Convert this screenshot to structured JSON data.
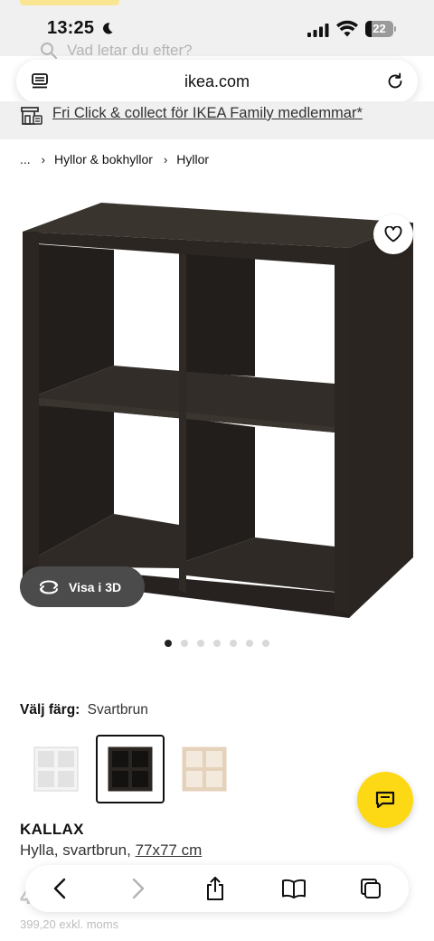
{
  "status_bar": {
    "time": "13:25",
    "battery": "22"
  },
  "site_search": {
    "placeholder": "Vad letar du efter?"
  },
  "address_bar": {
    "url": "ikea.com"
  },
  "promo": {
    "text": "Fri Click & collect för IKEA Family medlemmar*"
  },
  "breadcrumb": {
    "ellipsis": "...",
    "items": [
      "Hyllor & bokhyllor",
      "Hyllor"
    ]
  },
  "gallery": {
    "view_3d_label": "Visa i 3D",
    "image_count": 7,
    "active_index": 0
  },
  "colour": {
    "heading": "Välj färg:",
    "selected": "Svartbrun",
    "swatch_colors": [
      "#f4f4f4",
      "#2b2622",
      "#e4d2bb"
    ],
    "selected_index": 1
  },
  "product": {
    "name": "KALLAX",
    "description": "Hylla, svartbrun,",
    "size": "77x77 cm",
    "price_partial": "4",
    "price_excl": "399,20 exkl. moms"
  },
  "colors": {
    "accent_yellow": "#fdd915",
    "shelf_dark": "#2b2622"
  }
}
